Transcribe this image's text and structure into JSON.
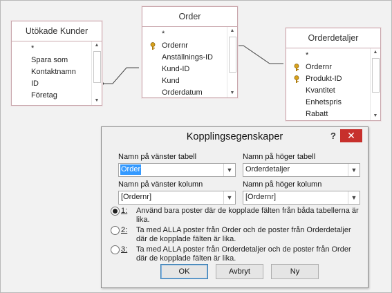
{
  "tables": {
    "utokade_kunder": {
      "title": "Utökade Kunder",
      "fields": [
        "*",
        "Spara som",
        "Kontaktnamn",
        "ID",
        "Företag"
      ]
    },
    "order": {
      "title": "Order",
      "fields": [
        "*",
        "Ordernr",
        "Anställnings-ID",
        "Kund-ID",
        "Kund",
        "Orderdatum"
      ]
    },
    "orderdetaljer": {
      "title": "Orderdetaljer",
      "fields": [
        "*",
        "Ordernr",
        "Produkt-ID",
        "Kvantitet",
        "Enhetspris",
        "Rabatt"
      ]
    }
  },
  "dialog": {
    "title": "Kopplingsegenskaper",
    "help": "?",
    "close": "✕",
    "left_table_label": "Namn på vänster tabell",
    "left_table_value": "Order",
    "right_table_label": "Namn på höger tabell",
    "right_table_value": "Orderdetaljer",
    "left_column_label": "Namn på vänster kolumn",
    "left_column_value": "[Ordernr]",
    "right_column_label": "Namn på höger kolumn",
    "right_column_value": "[Ordernr]",
    "options": [
      {
        "num": "1:",
        "line1": "Använd bara poster där de kopplade fälten från båda tabellerna är",
        "line2": "lika.",
        "selected": true
      },
      {
        "num": "2:",
        "line1": "Ta med ALLA poster från Order och de poster från Orderdetaljer",
        "line2": "där de kopplade fälten är lika.",
        "selected": false
      },
      {
        "num": "3:",
        "line1": "Ta med ALLA poster från Orderdetaljer och de poster från Order",
        "line2": "där de kopplade fälten är lika.",
        "selected": false
      }
    ],
    "ok_label": "OK",
    "cancel_label": "Avbryt",
    "new_label": "Ny"
  },
  "colors": {
    "table_border": "#c9a7ad",
    "close_button": "#c7302c",
    "selection": "#3399ff"
  },
  "icons": {
    "primary_key": "key-icon",
    "dropdown": "chevron-down-icon",
    "scroll_up": "arrow-up-icon",
    "scroll_down": "arrow-down-icon"
  }
}
